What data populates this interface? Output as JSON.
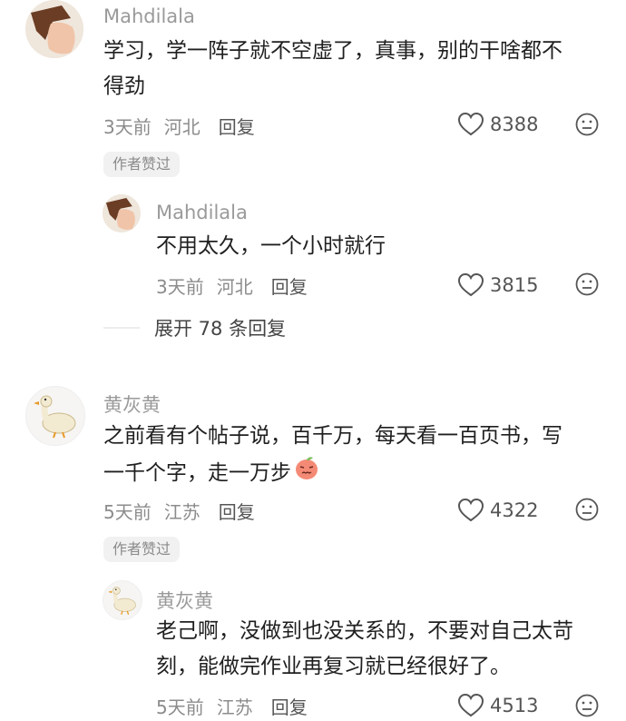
{
  "comments": [
    {
      "username": "Mahdilala",
      "content_line1": "学习，学一阵子就不空虚了，真事，别的干啥都不",
      "content_line2": "得劲",
      "time": "3天前",
      "location": "河北",
      "reply_label": "回复",
      "likes": "8388",
      "badge": "作者赞过",
      "replies": [
        {
          "username": "Mahdilala",
          "content": "不用太久，一个小时就行",
          "time": "3天前",
          "location": "河北",
          "reply_label": "回复",
          "likes": "3815"
        }
      ],
      "expand_label": "展开 78 条回复"
    },
    {
      "username": "黄灰黄",
      "content_line1": "之前看有个帖子说，百千万，每天看一百页书，写",
      "content_line2": "一千个字，走一万步",
      "time": "5天前",
      "location": "江苏",
      "reply_label": "回复",
      "likes": "4322",
      "badge": "作者赞过",
      "replies": [
        {
          "username": "黄灰黄",
          "content_line1": "老己啊，没做到也没关系的，不要对自己太苛",
          "content_line2": "刻，能做完作业再复习就已经很好了。",
          "time": "5天前",
          "location": "江苏",
          "reply_label": "回复",
          "likes": "4513"
        }
      ]
    }
  ],
  "icons": {
    "like": "heart-outline-icon",
    "dislike": "meh-face-icon",
    "inline_emoji": "angry-peach-emoji"
  },
  "colors": {
    "username": "#9a9a9a",
    "meta": "#8c8c8c",
    "badge_bg": "#f1f1f1"
  }
}
